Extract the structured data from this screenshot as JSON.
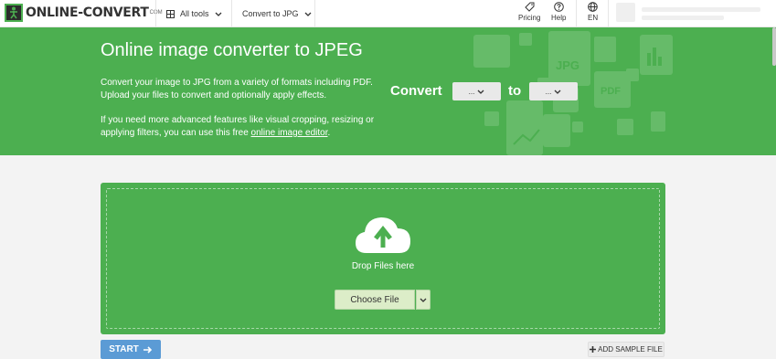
{
  "nav": {
    "logo_text": "ONLINE-CONVERT",
    "logo_suffix": "COM",
    "all_tools": "All tools",
    "convert_to": "Convert to JPG",
    "pricing": "Pricing",
    "help": "Help",
    "language": "EN"
  },
  "hero": {
    "title": "Online image converter to JPEG",
    "description": "Convert your image to JPG from a variety of formats including PDF. Upload your files to convert and optionally apply effects.",
    "advanced_text": "If you need more advanced features like visual cropping, resizing or applying filters, you can use this free ",
    "editor_link": "online image editor",
    "advanced_end": ".",
    "convert_label": "Convert",
    "from_value": "...",
    "to_label": "to",
    "to_value": "...",
    "deco_jpg": "JPG",
    "deco_pdf": "PDF"
  },
  "upload": {
    "drop_text": "Drop Files here",
    "choose_file": "Choose File"
  },
  "actions": {
    "start": "START",
    "add_sample": "ADD SAMPLE FILE"
  },
  "colors": {
    "brand_green": "#4caf50",
    "start_blue": "#5b9bd5"
  }
}
